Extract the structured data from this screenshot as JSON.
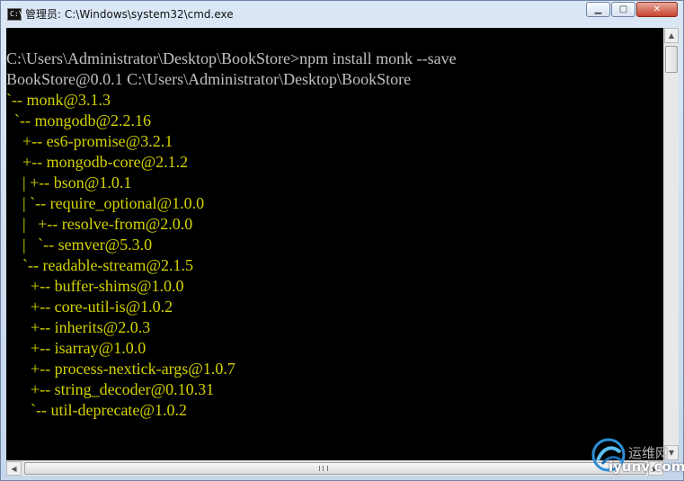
{
  "window": {
    "title": "管理员: C:\\Windows\\system32\\cmd.exe",
    "app_icon_text": "C:\\",
    "controls": [
      "minimize-icon",
      "maximize-icon",
      "close-icon"
    ]
  },
  "console": {
    "lines": [
      "C:\\Users\\Administrator\\Desktop\\BookStore>npm install monk --save",
      "BookStore@0.0.1 C:\\Users\\Administrator\\Desktop\\BookStore",
      "`-- monk@3.1.3",
      "  `-- mongodb@2.2.16",
      "    +-- es6-promise@3.2.1",
      "    +-- mongodb-core@2.1.2",
      "    | +-- bson@1.0.1",
      "    | `-- require_optional@1.0.0",
      "    |   +-- resolve-from@2.0.0",
      "    |   `-- semver@5.3.0",
      "    `-- readable-stream@2.1.5",
      "      +-- buffer-shims@1.0.0",
      "      +-- core-util-is@1.0.2",
      "      +-- inherits@2.0.3",
      "      +-- isarray@1.0.0",
      "      +-- process-nextick-args@1.0.7",
      "      +-- string_decoder@0.10.31",
      "      `-- util-deprecate@1.0.2"
    ]
  },
  "colors": {
    "console_background": "#000000",
    "console_text": "#c0c0c0",
    "package_text": "#d3d301"
  },
  "watermark": {
    "brand": "运维网",
    "url": "iyunv.com"
  }
}
